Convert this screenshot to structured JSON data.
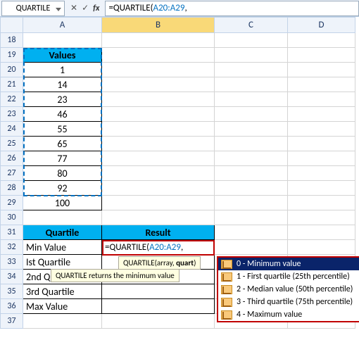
{
  "name_box": "QUARTILE",
  "fb": {
    "cancel": "✕",
    "enter": "✓",
    "fx": "fx",
    "prefix": "=QUARTILE(",
    "range": "A20:A29",
    "suffix": ","
  },
  "cols": {
    "rh": "",
    "A": "A",
    "B": "B",
    "C": "C",
    "D": "D"
  },
  "rows": [
    "18",
    "19",
    "20",
    "21",
    "22",
    "23",
    "24",
    "25",
    "26",
    "27",
    "28",
    "29",
    "30",
    "31",
    "32",
    "33",
    "34",
    "35",
    "36",
    "37"
  ],
  "values_header": "Values",
  "values": [
    "1",
    "14",
    "23",
    "46",
    "55",
    "65",
    "77",
    "80",
    "92",
    "100"
  ],
  "quartile_header": "Quartile",
  "result_header": "Result",
  "labels": [
    "Min Value",
    "Ist Quartile",
    "2nd Q",
    "3rd Quartile",
    "Max Value"
  ],
  "edit": {
    "prefix": "=QUARTILE(",
    "range": "A20:A29",
    "suffix": ","
  },
  "tooltip": {
    "pre": "QUARTILE(array, ",
    "bold": "quart",
    "post": ")"
  },
  "tooltip_left": "QUARTILE returns the minimum value",
  "intelli": [
    "0 - Minimum value",
    "1 - First quartile (25th percentile)",
    "2 - Median value (50th percentile)",
    "3 - Third quartile (75th percentile)",
    "4 - Maximum value"
  ],
  "colors": {
    "accent": "#00b0f0",
    "highlight": "#c00000",
    "range": "#0070c0"
  }
}
